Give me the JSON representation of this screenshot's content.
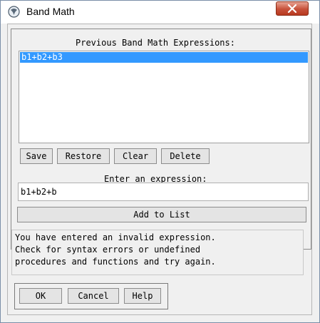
{
  "window": {
    "title": "Band Math",
    "close_icon": "close-icon",
    "app_icon": "envi-app-icon"
  },
  "expressions": {
    "heading": "Previous Band Math Expressions:",
    "items": [
      "b1+b2+b3"
    ],
    "selected_index": 0
  },
  "list_buttons": {
    "save": "Save",
    "restore": "Restore",
    "clear": "Clear",
    "delete": "Delete"
  },
  "expression_input": {
    "label": "Enter an expression:",
    "value": "b1+b2+b"
  },
  "add_to_list": "Add to List",
  "message": {
    "lines": [
      "You have entered an invalid expression.",
      "Check for syntax errors or undefined",
      "procedures and functions and try again."
    ]
  },
  "dialog_buttons": {
    "ok": "OK",
    "cancel": "Cancel",
    "help": "Help"
  },
  "colors": {
    "selection": "#3399ff",
    "close_button": "#c7513a"
  }
}
